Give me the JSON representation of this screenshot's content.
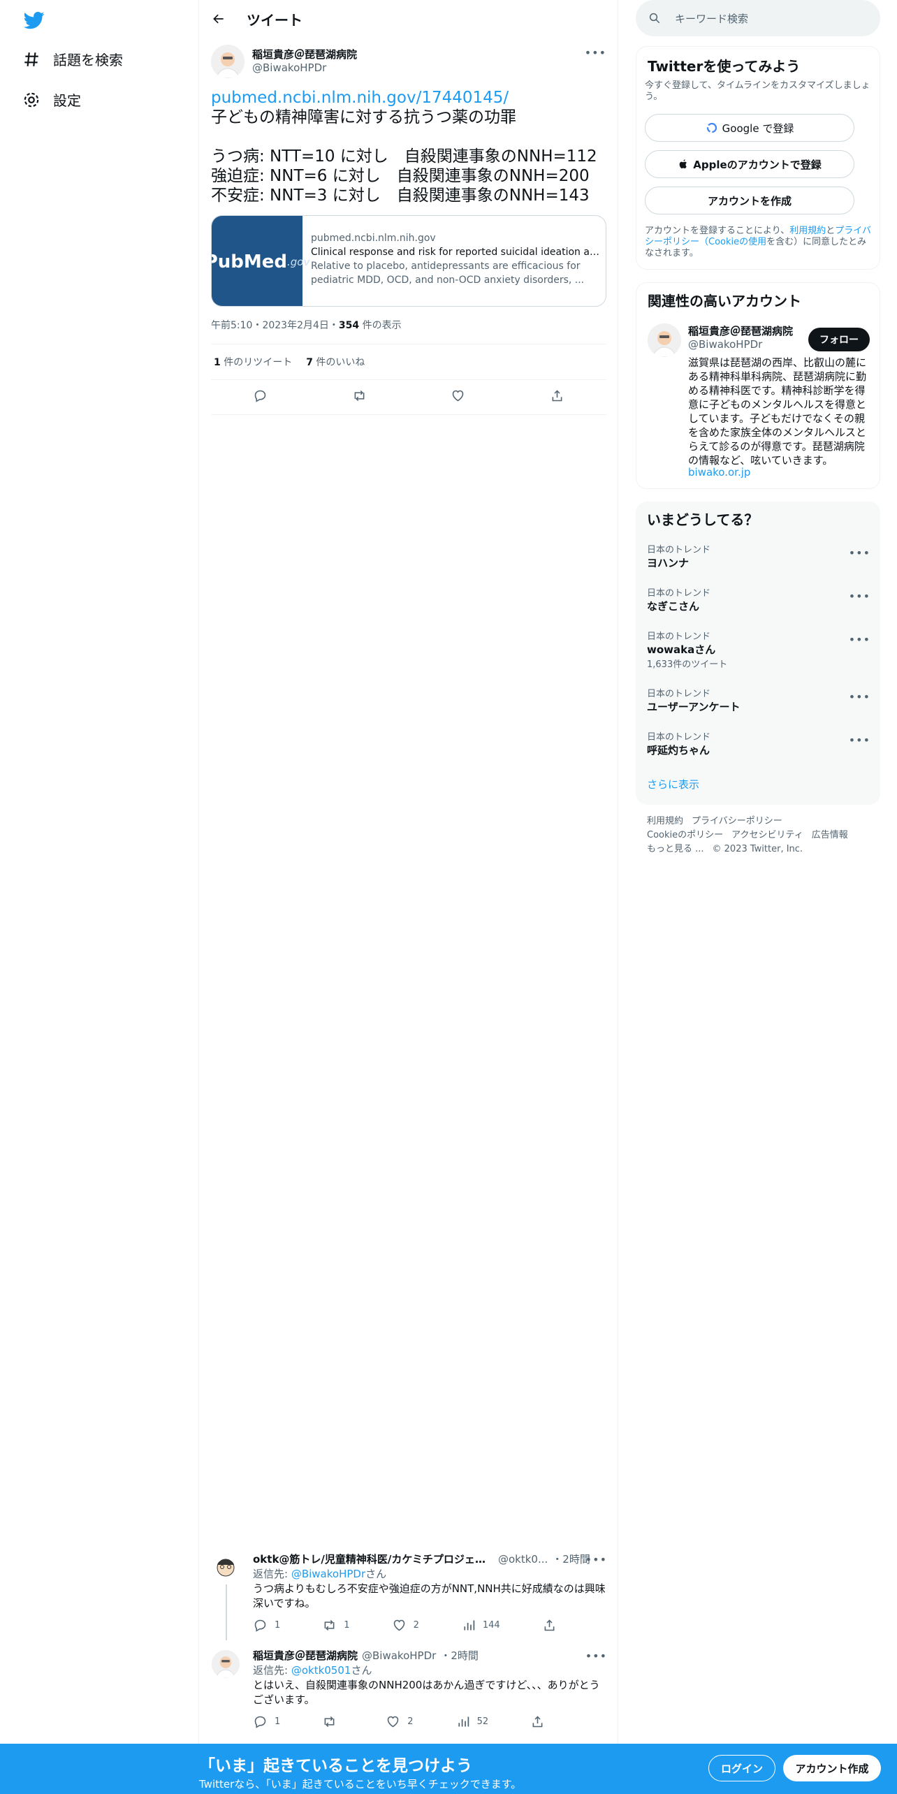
{
  "nav": {
    "explore": "話題を検索",
    "settings": "設定"
  },
  "header": {
    "title": "ツイート"
  },
  "tweet": {
    "name": "稲垣貴彦＠琵琶湖病院",
    "handle": "@BiwakoHPDr",
    "link": "pubmed.ncbi.nlm.nih.gov/17440145/",
    "lines": [
      "子どもの精神障害に対する抗うつ薬の功罪",
      "",
      "うつ病: NTT=10 に対し　自殺関連事象のNNH=112",
      "強迫症: NNT=6 に対し　自殺関連事象のNNH=200",
      "不安症: NNT=3 に対し　自殺関連事象のNNH=143"
    ],
    "card": {
      "img_main": "PubMed",
      "img_suffix": ".gov",
      "domain": "pubmed.ncbi.nlm.nih.gov",
      "title": "Clinical response and risk for reported suicidal ideation and ...",
      "desc": "Relative to placebo, antidepressants are efficacious for pediatric MDD, OCD, and non-OCD anxiety disorders, ..."
    },
    "time": "午前5:10・2023年2月4日・",
    "views_num": "354",
    "views_label": " 件の表示",
    "retweets_num": "1",
    "retweets_label": " 件のリツイート",
    "likes_num": "7",
    "likes_label": " 件のいいね"
  },
  "replies": [
    {
      "name": "oktk@筋トレ/児童精神科医/カケミチプロジェクト",
      "handle": "@oktk0...",
      "time": "・2時間",
      "to_label": "返信先: ",
      "to_user": "@BiwakoHPDr",
      "to_suffix": "さん",
      "text": "うつ病よりもむしろ不安症や強迫症の方がNNT,NNH共に好成績なのは興味深いですね。",
      "replies": "1",
      "retweets": "1",
      "likes": "2",
      "views": "144"
    },
    {
      "name": "稲垣貴彦＠琵琶湖病院",
      "handle": "@BiwakoHPDr",
      "time": "・2時間",
      "to_label": "返信先: ",
      "to_user": "@oktk0501",
      "to_suffix": "さん",
      "text": "とはいえ、自殺関連事象のNNH200はあかん過ぎですけど、、、ありがとうございます。",
      "replies": "1",
      "retweets": "",
      "likes": "2",
      "views": "52"
    }
  ],
  "search": {
    "placeholder": "キーワード検索"
  },
  "signup": {
    "title": "Twitterを使ってみよう",
    "sub": "今すぐ登録して、タイムラインをカスタマイズしましょう。",
    "google": "Google で登録",
    "apple": "Appleのアカウントで登録",
    "create": "アカウントを作成",
    "legal_a": "アカウントを登録することにより、",
    "legal_terms": "利用規約",
    "legal_and": "と",
    "legal_privacy": "プライバシーポリシー（Cookieの使用",
    "legal_b": "を含む）に同意したとみなされます。"
  },
  "related": {
    "title": "関連性の高いアカウント",
    "name": "稲垣貴彦＠琵琶湖病院",
    "handle": "@BiwakoHPDr",
    "follow": "フォロー",
    "bio": "滋賀県は琵琶湖の西岸、比叡山の麓にある精神科単科病院、琵琶湖病院に勤める精神科医です。精神科診断学を得意に子どものメンタルヘルスを得意としています。子どもだけでなくその親を含めた家族全体のメンタルヘルスとらえて診るのが得意です。琵琶湖病院の情報など、呟いていきます。",
    "url": "biwako.or.jp"
  },
  "trends": {
    "title": "いまどうしてる？",
    "items": [
      {
        "cat": "日本のトレンド",
        "name": "ヨハンナ",
        "count": ""
      },
      {
        "cat": "日本のトレンド",
        "name": "なぎこさん",
        "count": ""
      },
      {
        "cat": "日本のトレンド",
        "name": "wowakaさん",
        "count": "1,633件のツイート"
      },
      {
        "cat": "日本のトレンド",
        "name": "ユーザーアンケート",
        "count": ""
      },
      {
        "cat": "日本のトレンド",
        "name": "呼延灼ちゃん",
        "count": ""
      }
    ],
    "more": "さらに表示"
  },
  "footer": [
    "利用規約",
    "プライバシーポリシー",
    "Cookieのポリシー",
    "アクセシビリティ",
    "広告情報",
    "もっと見る ...",
    "© 2023 Twitter, Inc."
  ],
  "bottom": {
    "headline": "「いま」起きていることを見つけよう",
    "sub": "Twitterなら、「いま」起きていることをいち早くチェックできます。",
    "login": "ログイン",
    "signup": "アカウント作成"
  },
  "colors": {
    "brand": "#1d9bf0",
    "text": "#0f1419",
    "secondary": "#536471"
  }
}
